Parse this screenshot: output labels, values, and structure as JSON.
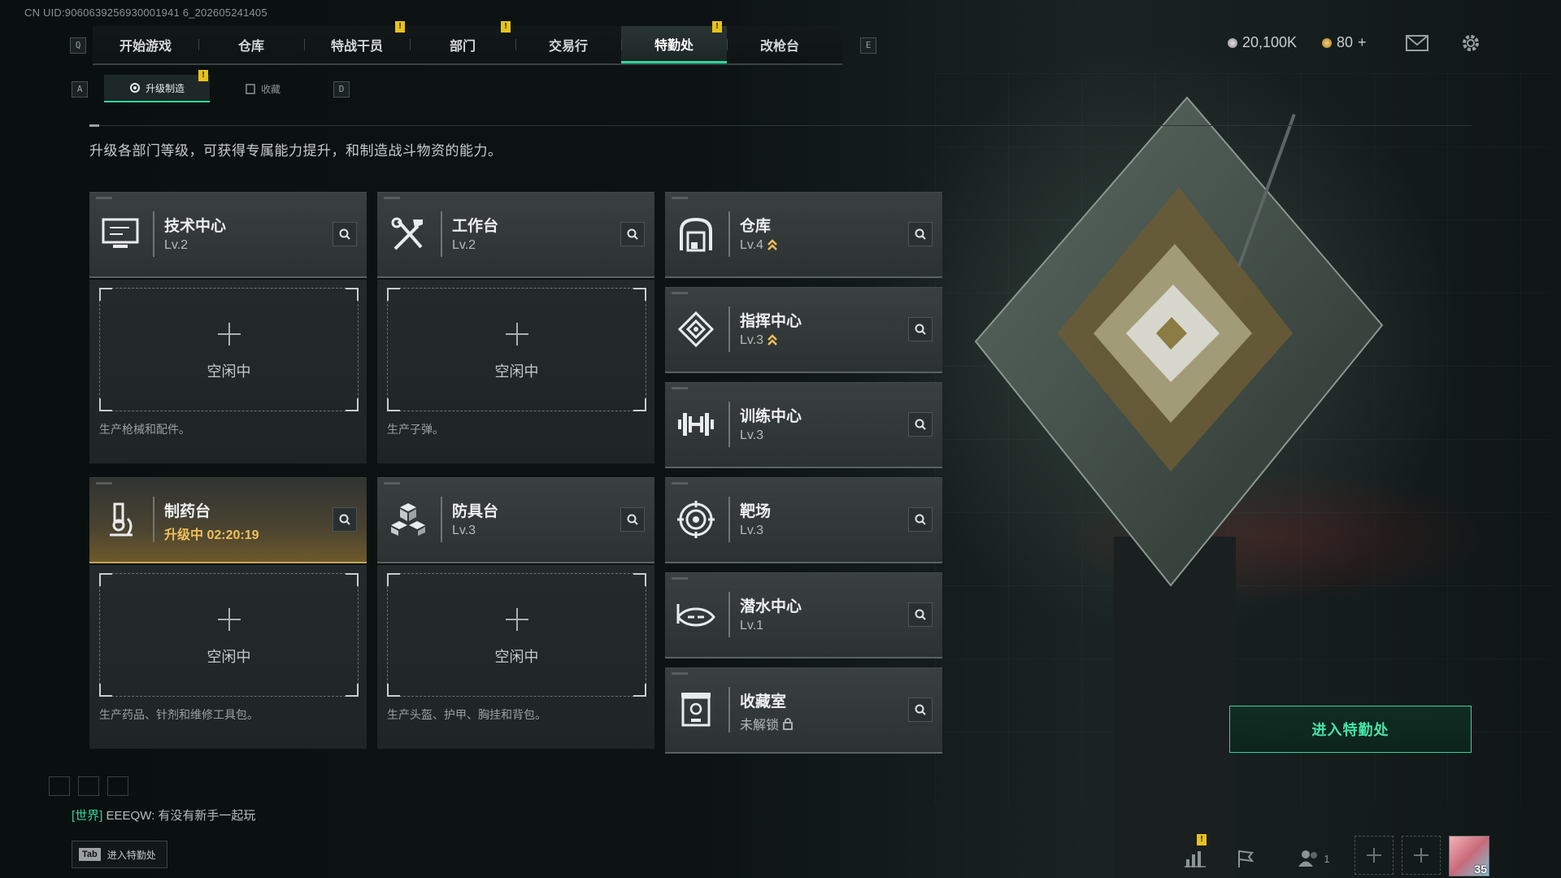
{
  "uid_text": "CN UID:9060639256930001941 6_202605241405",
  "nav": {
    "key_left": "Q",
    "key_right": "E",
    "tabs": [
      {
        "label": "开始游戏",
        "alert": false
      },
      {
        "label": "仓库",
        "alert": false
      },
      {
        "label": "特战干员",
        "alert": true
      },
      {
        "label": "部门",
        "alert": true
      },
      {
        "label": "交易行",
        "alert": false
      },
      {
        "label": "特勤处",
        "alert": true,
        "active": true
      },
      {
        "label": "改枪台",
        "alert": false
      }
    ],
    "alert_glyph": "!"
  },
  "top_right": {
    "currency1": "20,100K",
    "currency2": "80",
    "currency2_plus": "+"
  },
  "subtabs": {
    "key_left": "A",
    "key_right": "D",
    "items": [
      {
        "label": "升级制造",
        "active": true,
        "alert": true
      },
      {
        "label": "收藏",
        "active": false,
        "alert": false
      }
    ]
  },
  "description": "升级各部门等级，可获得专属能力提升，和制造战斗物资的能力。",
  "departments": [
    {
      "name": "技术中心",
      "level": "Lv.2",
      "icon": "monitor-icon",
      "slot_desc": "生产枪械和配件。"
    },
    {
      "name": "工作台",
      "level": "Lv.2",
      "icon": "tools-icon",
      "slot_desc": "生产子弹。"
    },
    {
      "name": "仓库",
      "level": "Lv.4",
      "icon": "warehouse-icon",
      "upgradable": true
    },
    {
      "name": "指挥中心",
      "level": "Lv.3",
      "icon": "command-icon",
      "upgradable": true
    },
    {
      "name": "训练中心",
      "level": "Lv.3",
      "icon": "dumbbell-icon"
    },
    {
      "name": "制药台",
      "level": "升级中 02:20:19",
      "icon": "microscope-icon",
      "upgrading": true,
      "slot_desc": "生产药品、针剂和维修工具包。"
    },
    {
      "name": "防具台",
      "level": "Lv.3",
      "icon": "armor-blocks-icon",
      "slot_desc": "生产头盔、护甲、胸挂和背包。"
    },
    {
      "name": "靶场",
      "level": "Lv.3",
      "icon": "target-icon"
    },
    {
      "name": "潜水中心",
      "level": "Lv.1",
      "icon": "diving-mask-icon"
    },
    {
      "name": "收藏室",
      "level": "未解锁",
      "icon": "trophy-case-icon",
      "locked": true
    }
  ],
  "slot_idle_label": "空闲中",
  "enter_button": "进入特勤处",
  "chat": {
    "channel": "[世界]",
    "message": "EEEQW: 有没有新手一起玩"
  },
  "tab_hint": {
    "key": "Tab",
    "label": "进入特勤处"
  },
  "bottom_bar": {
    "friends_count": "1",
    "avatar_level": "35",
    "alert_glyph": "!"
  },
  "colors": {
    "accent_green": "#2fd69a",
    "alert_yellow": "#e8c21a",
    "upgrade_gold": "#f0c05a"
  }
}
